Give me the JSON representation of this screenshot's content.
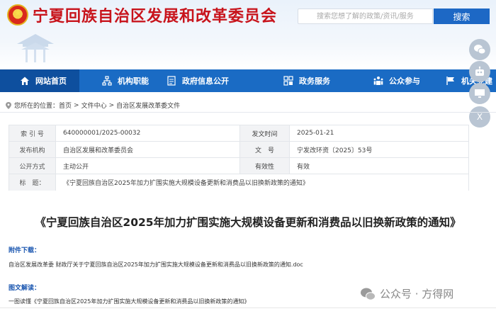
{
  "header": {
    "site_title": "宁夏回族自治区发展和改革委员会",
    "search_placeholder": "搜索您想了解的政策/资讯/服务",
    "search_button": "搜索"
  },
  "nav": {
    "items": [
      {
        "label": "网站首页",
        "icon": "home-icon"
      },
      {
        "label": "机构职能",
        "icon": "org-chart-icon"
      },
      {
        "label": "政府信息公开",
        "icon": "document-icon"
      },
      {
        "label": "政务服务",
        "icon": "services-icon"
      },
      {
        "label": "公众参与",
        "icon": "people-icon"
      },
      {
        "label": "机关党建",
        "icon": "flag-icon"
      }
    ]
  },
  "float": {
    "items": [
      {
        "name": "wechat-icon"
      },
      {
        "name": "robot-icon"
      },
      {
        "name": "monitor-icon"
      },
      {
        "label": "X",
        "name": "close-icon"
      }
    ]
  },
  "breadcrumb": {
    "prefix": "您所在的位置：",
    "items": [
      "首页",
      "文件中心",
      "自治区发展改革委文件"
    ],
    "sep": ">"
  },
  "info": {
    "index_label": "索 引 号",
    "index_value": "640000001/2025-00032",
    "date_label": "发文时间",
    "date_value": "2025-01-21",
    "issuer_label": "发布机构",
    "issuer_value": "自治区发展和改革委员会",
    "docno_label": "文　号",
    "docno_value": "宁发改环资〔2025〕53号",
    "open_label": "公开方式",
    "open_value": "主动公开",
    "validity_label": "有效性",
    "validity_value": "有效",
    "title_label": "标　题：",
    "title_value": "《宁夏回族自治区2025年加力扩围实施大规模设备更新和消费品以旧换新政策的通知》"
  },
  "main": {
    "title": "《宁夏回族自治区2025年加力扩围实施大规模设备更新和消费品以旧换新政策的通知》",
    "attach_head": "附件下载：",
    "attach_text": "自治区发展改革委 财政厅关于宁夏回族自治区2025年加力扩围实施大规模设备更新和消费品以旧换新政策的通知.doc",
    "interpret_head": "图文解读：",
    "interpret_text": "一图读懂《宁夏回族自治区2025年加力扩围实施大规模设备更新和消费品以旧换新政策的通知》"
  },
  "watermark": "公众号 · 方得网",
  "colors": {
    "brand_red": "#c8141c",
    "nav_blue": "#1a6bc4",
    "accent_blue": "#1a56b0"
  }
}
